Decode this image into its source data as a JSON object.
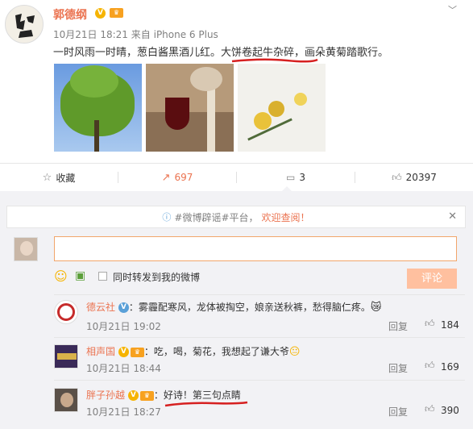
{
  "post": {
    "author": "郭德纲",
    "time": "10月21日 18:21",
    "source_prefix": "来自",
    "source": "iPhone 6 Plus",
    "text_a": "一时风雨一时晴，葱白酱黑酒儿红。",
    "text_b": "大饼卷起牛杂碎",
    "text_c": "，画朵黄菊踏歌行。"
  },
  "actions": {
    "favorite": "收藏",
    "repost": "697",
    "comment": "3",
    "like": "20397"
  },
  "notice": {
    "prefix": "#微博辟谣#平台，",
    "link": "欢迎查阅！"
  },
  "composer": {
    "value": "",
    "also_repost": "同时转发到我的微博",
    "submit": "评论"
  },
  "comments": [
    {
      "user": "德云社",
      "text": "：雾霾配寒风，龙体被掏空，娘亲送秋裤，愁得脑仁疼。",
      "time": "10月21日 19:02",
      "reply": "回复",
      "likes": "184"
    },
    {
      "user": "相声国",
      "text": "：吃，喝，菊花，我想起了谦大爷",
      "time": "10月21日 18:44",
      "reply": "回复",
      "likes": "169"
    },
    {
      "user": "胖子孙越",
      "text": "：好诗！第三句点睛",
      "time": "10月21日 18:27",
      "reply": "回复",
      "likes": "390"
    }
  ],
  "colors": {
    "accent": "#eb7350",
    "underline": "#d62020",
    "badge": "#f6b400"
  }
}
